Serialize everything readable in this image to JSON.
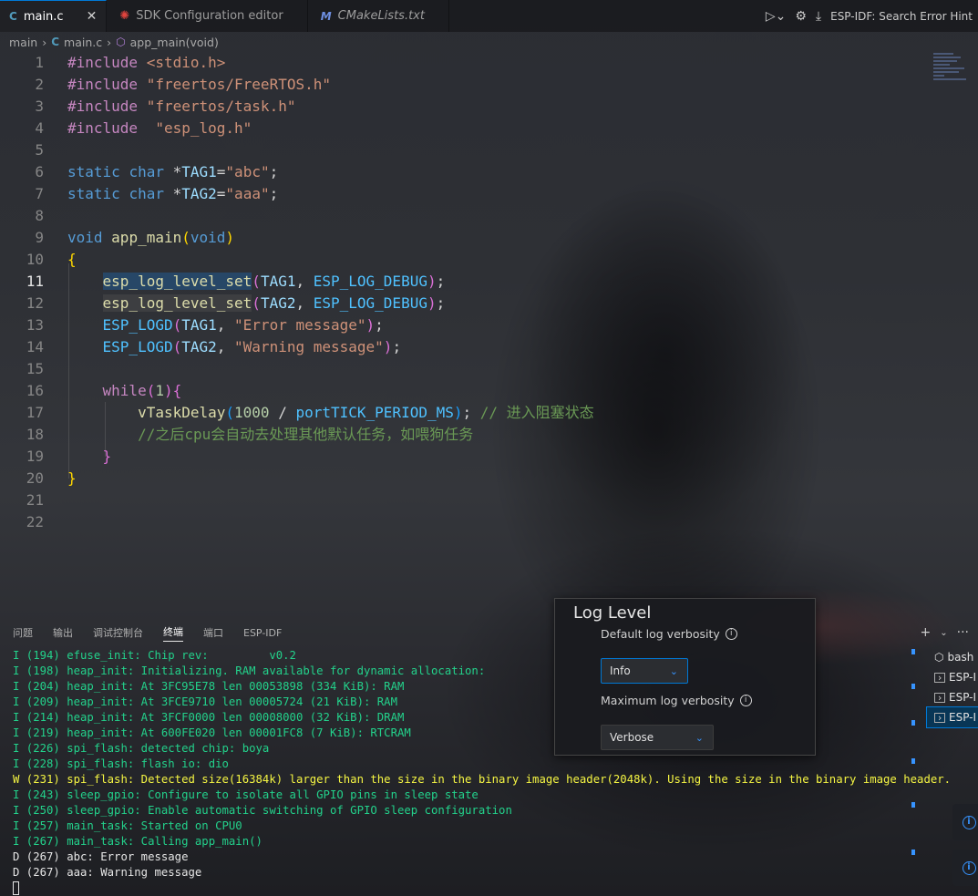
{
  "tabs": [
    {
      "icon": "C",
      "label": "main.c",
      "close": "✕"
    },
    {
      "label": "SDK Configuration editor"
    },
    {
      "icon": "M",
      "label": "CMakeLists.txt"
    }
  ],
  "tab_actions": {
    "espidf_hint": "ESP-IDF: Search Error Hint"
  },
  "breadcrumb": {
    "folder": "main",
    "file_icon": "C",
    "file": "main.c",
    "symbol": "app_main(void)"
  },
  "editor": {
    "line_numbers": [
      "1",
      "2",
      "3",
      "4",
      "5",
      "6",
      "7",
      "8",
      "9",
      "10",
      "11",
      "12",
      "13",
      "14",
      "15",
      "16",
      "17",
      "18",
      "19",
      "20",
      "21",
      "22"
    ],
    "current_line": "11",
    "code": {
      "l1": {
        "kw": "#include",
        "arg": "<stdio.h>"
      },
      "l2": {
        "kw": "#include",
        "arg": "\"freertos/FreeRTOS.h\""
      },
      "l3": {
        "kw": "#include",
        "arg": "\"freertos/task.h\""
      },
      "l4": {
        "kw": "#include",
        "arg": "\"esp_log.h\""
      },
      "l6": {
        "static": "static",
        "type": "char",
        "star": "*",
        "name": "TAG1",
        "eq": "=",
        "val": "\"abc\"",
        "semi": ";"
      },
      "l7": {
        "static": "static",
        "type": "char",
        "star": "*",
        "name": "TAG2",
        "eq": "=",
        "val": "\"aaa\"",
        "semi": ";"
      },
      "l9": {
        "type": "void",
        "fn": "app_main",
        "open": "(",
        "arg": "void",
        "close": ")"
      },
      "l10": "{",
      "l11": {
        "fn": "esp_log_level_set",
        "open": "(",
        "a1": "TAG1",
        "comma": ", ",
        "a2": "ESP_LOG_DEBUG",
        "close": ")",
        "semi": ";"
      },
      "l12": {
        "fn": "esp_log_level_set",
        "open": "(",
        "a1": "TAG2",
        "comma": ", ",
        "a2": "ESP_LOG_DEBUG",
        "close": ")",
        "semi": ";"
      },
      "l13": {
        "fn": "ESP_LOGD",
        "open": "(",
        "a1": "TAG1",
        "comma": ", ",
        "a2": "\"Error message\"",
        "close": ")",
        "semi": ";"
      },
      "l14": {
        "fn": "ESP_LOGD",
        "open": "(",
        "a1": "TAG2",
        "comma": ", ",
        "a2": "\"Warning message\"",
        "close": ")",
        "semi": ";"
      },
      "l16": {
        "kw": "while",
        "open": "(",
        "num": "1",
        "close": ")",
        "brace": "{"
      },
      "l17": {
        "fn": "vTaskDelay",
        "open": "(",
        "num": "1000",
        "op": " / ",
        "macro": "portTICK_PERIOD_MS",
        "close": ")",
        "semi": ";",
        "comment": "// 进入阻塞状态"
      },
      "l18": {
        "comment": "//之后cpu会自动去处理其他默认任务，如喂狗任务"
      },
      "l19": "}",
      "l20": "}"
    }
  },
  "panel": {
    "tabs": [
      "问题",
      "输出",
      "调试控制台",
      "终端",
      "端口",
      "ESP-IDF"
    ],
    "active_tab": "终端",
    "actions": {
      "add": "+",
      "more": "···"
    }
  },
  "terminal": {
    "lines": [
      {
        "level": "I",
        "text": "I (194) efuse_init: Chip rev:         v0.2"
      },
      {
        "level": "I",
        "text": "I (198) heap_init: Initializing. RAM available for dynamic allocation:"
      },
      {
        "level": "I",
        "text": "I (204) heap_init: At 3FC95E78 len 00053898 (334 KiB): RAM"
      },
      {
        "level": "I",
        "text": "I (209) heap_init: At 3FCE9710 len 00005724 (21 KiB): RAM"
      },
      {
        "level": "I",
        "text": "I (214) heap_init: At 3FCF0000 len 00008000 (32 KiB): DRAM"
      },
      {
        "level": "I",
        "text": "I (219) heap_init: At 600FE020 len 00001FC8 (7 KiB): RTCRAM"
      },
      {
        "level": "I",
        "text": "I (226) spi_flash: detected chip: boya"
      },
      {
        "level": "I",
        "text": "I (228) spi_flash: flash io: dio"
      },
      {
        "level": "W",
        "text": "W (231) spi_flash: Detected size(16384k) larger than the size in the binary image header(2048k). Using the size in the binary image header."
      },
      {
        "level": "I",
        "text": "I (243) sleep_gpio: Configure to isolate all GPIO pins in sleep state"
      },
      {
        "level": "I",
        "text": "I (250) sleep_gpio: Enable automatic switching of GPIO sleep configuration"
      },
      {
        "level": "I",
        "text": "I (257) main_task: Started on CPU0"
      },
      {
        "level": "I",
        "text": "I (267) main_task: Calling app_main()"
      },
      {
        "level": "D",
        "text": "D (267) abc: Error message"
      },
      {
        "level": "D",
        "text": "D (267) aaa: Warning message"
      }
    ]
  },
  "terminal_list": [
    "bash",
    "ESP-I",
    "ESP-I",
    "ESP-I"
  ],
  "log_level": {
    "title": "Log Level",
    "default_label": "Default log verbosity",
    "default_value": "Info",
    "max_label": "Maximum log verbosity",
    "max_value": "Verbose",
    "info_glyph": "i"
  },
  "colors": {
    "accent": "#0078d4",
    "info_green": "#23d18b",
    "warn_yellow": "#f5f543"
  }
}
